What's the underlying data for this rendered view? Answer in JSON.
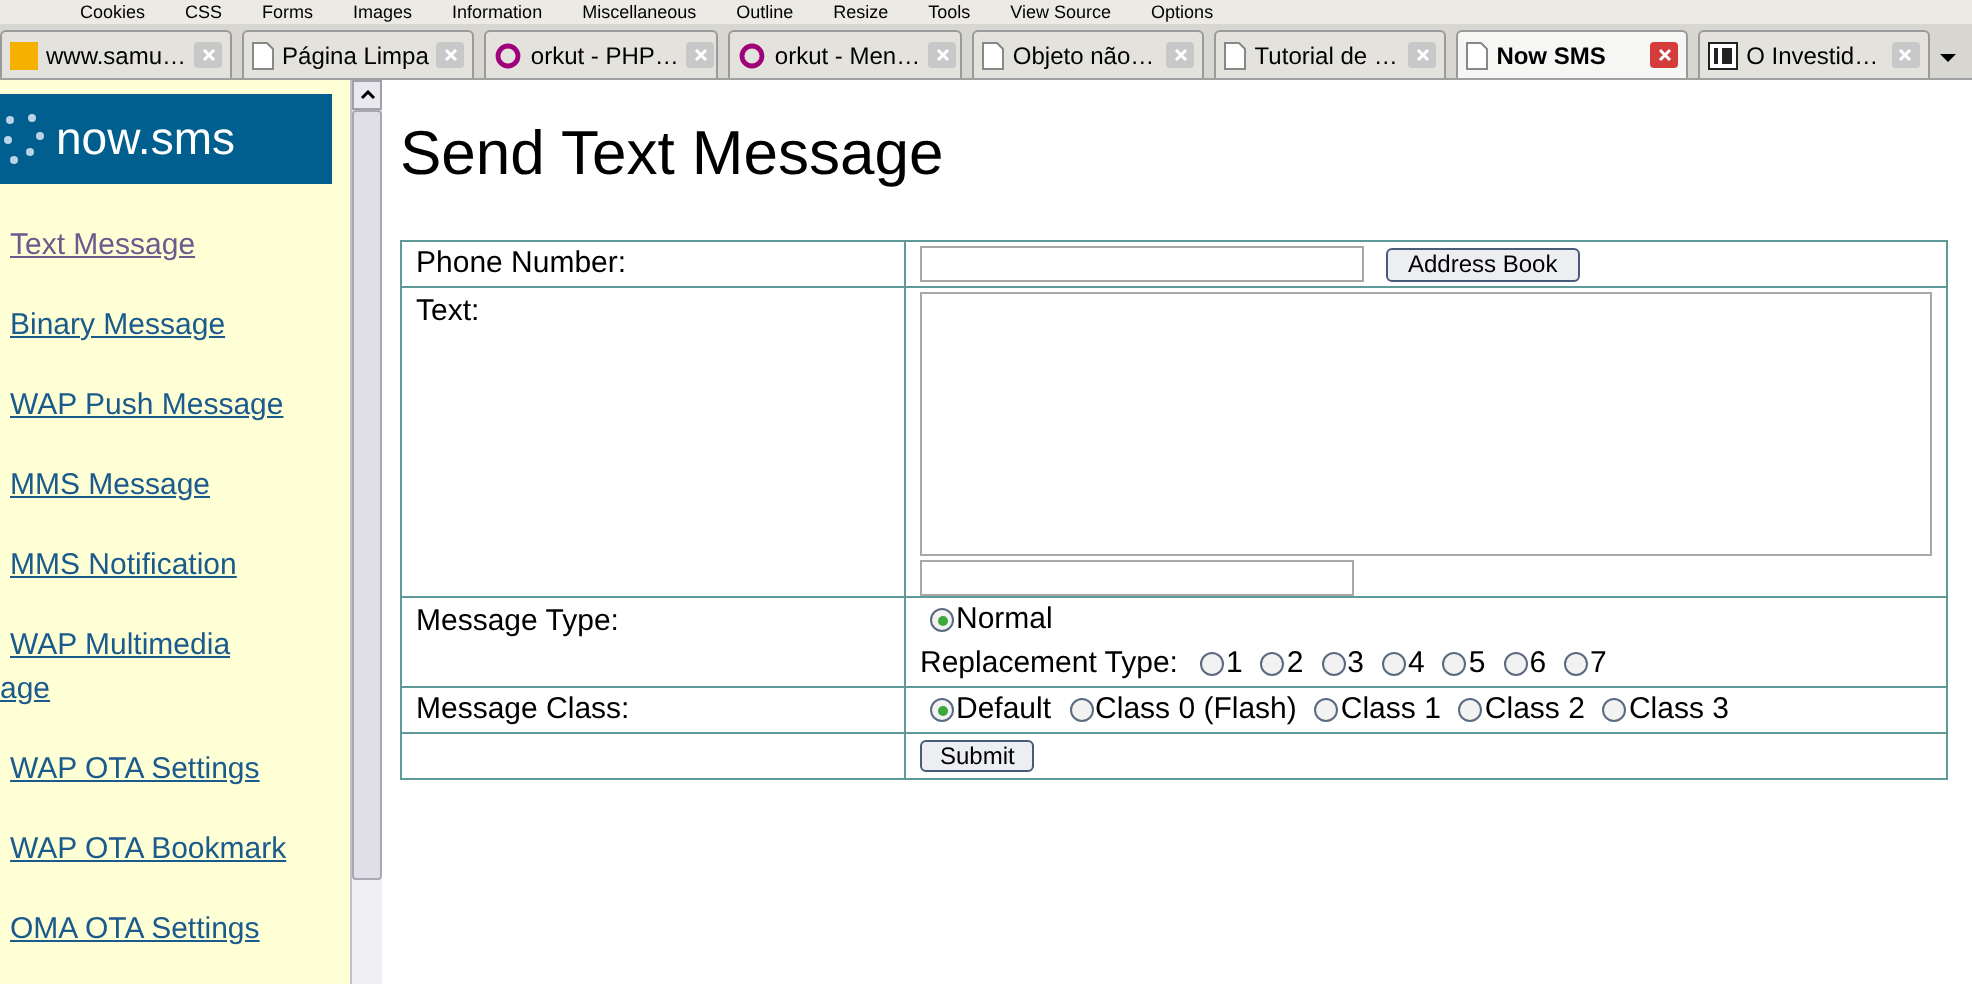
{
  "toolbar": [
    "Cookies",
    "CSS",
    "Forms",
    "Images",
    "Information",
    "Miscellaneous",
    "Outline",
    "Resize",
    "Tools",
    "View Source",
    "Options"
  ],
  "tabs": [
    {
      "label": "www.samu…",
      "kind": "logo",
      "selected": false
    },
    {
      "label": "Página Limpa",
      "kind": "page",
      "selected": false
    },
    {
      "label": "orkut - PHP…",
      "kind": "ring",
      "selected": false
    },
    {
      "label": "orkut - Men…",
      "kind": "ring",
      "selected": false
    },
    {
      "label": "Objeto não…",
      "kind": "page",
      "selected": false
    },
    {
      "label": "Tutorial de …",
      "kind": "page",
      "selected": false
    },
    {
      "label": "Now SMS",
      "kind": "page",
      "selected": true
    },
    {
      "label": "O Investid…",
      "kind": "ia",
      "selected": false
    }
  ],
  "sidebar": {
    "logo": "now.sms",
    "links": [
      {
        "label": "Text Message",
        "visited": true
      },
      {
        "label": "Binary Message",
        "visited": false
      },
      {
        "label": "WAP Push Message",
        "visited": false
      },
      {
        "label": "MMS Message",
        "visited": false
      },
      {
        "label": "MMS Notification",
        "visited": false
      },
      {
        "label": "WAP Multimedia",
        "continuation": "age",
        "visited": false
      },
      {
        "label": "WAP OTA Settings",
        "visited": false
      },
      {
        "label": "WAP OTA Bookmark",
        "visited": false
      },
      {
        "label": "OMA OTA Settings",
        "visited": false
      }
    ]
  },
  "page": {
    "title": "Send Text Message",
    "phone_label": "Phone Number:",
    "address_book": "Address Book",
    "text_label": "Text:",
    "message_type_label": "Message Type:",
    "message_type": [
      {
        "label": "Normal",
        "selected": true
      }
    ],
    "replacement_label": "Replacement Type:",
    "replacement": [
      {
        "label": "1",
        "selected": false
      },
      {
        "label": "2",
        "selected": false
      },
      {
        "label": "3",
        "selected": false
      },
      {
        "label": "4",
        "selected": false
      },
      {
        "label": "5",
        "selected": false
      },
      {
        "label": "6",
        "selected": false
      },
      {
        "label": "7",
        "selected": false
      }
    ],
    "class_label": "Message Class:",
    "classes": [
      {
        "label": "Default",
        "selected": true
      },
      {
        "label": "Class 0 (Flash)",
        "selected": false
      },
      {
        "label": "Class 1",
        "selected": false
      },
      {
        "label": "Class 2",
        "selected": false
      },
      {
        "label": "Class 3",
        "selected": false
      }
    ],
    "submit": "Submit"
  }
}
